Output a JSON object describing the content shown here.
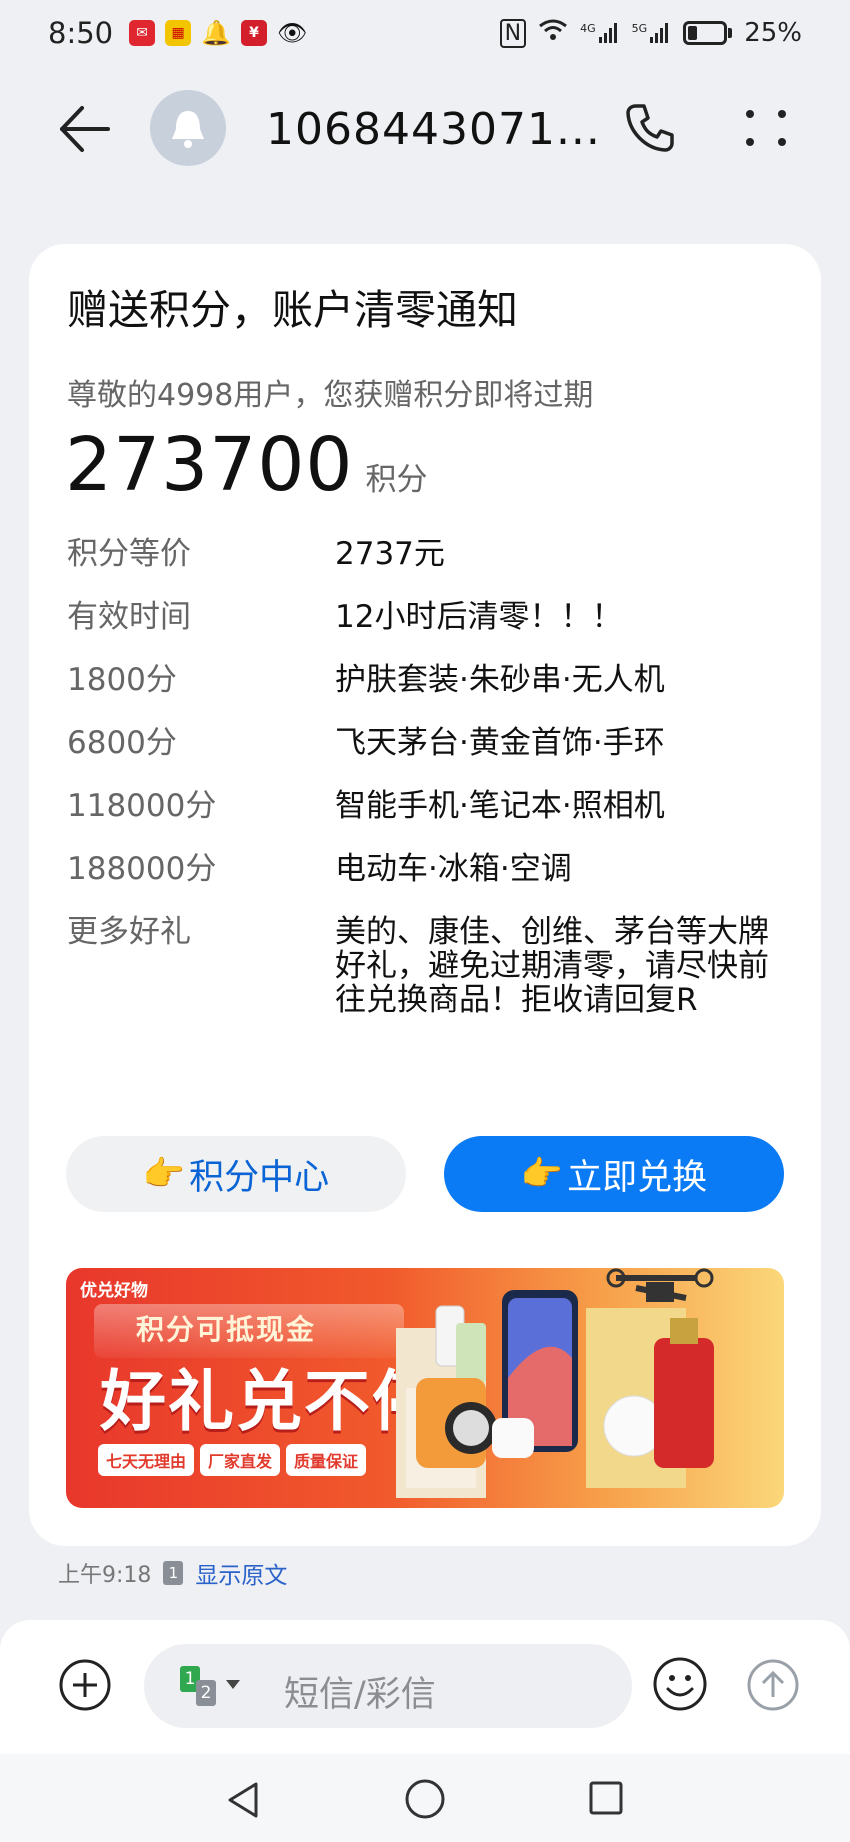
{
  "status_bar": {
    "time": "8:50",
    "network_4g": "4G",
    "network_5g": "5G",
    "battery": "25%"
  },
  "header": {
    "sender": "1068443071..."
  },
  "message": {
    "title": "赠送积分，账户清零通知",
    "subtitle": "尊敬的4998用户，您获赠积分即将过期",
    "points_value": "273700",
    "points_unit": "积分",
    "rows": [
      {
        "label": "积分等价",
        "value": "2737元"
      },
      {
        "label": "有效时间",
        "value": "12小时后清零！！！"
      },
      {
        "label": "1800分",
        "value": "护肤套装·朱砂串·无人机"
      },
      {
        "label": "6800分",
        "value": "飞天茅台·黄金首饰·手环"
      },
      {
        "label": "118000分",
        "value": "智能手机·笔记本·照相机"
      },
      {
        "label": "188000分",
        "value": "电动车·冰箱·空调"
      },
      {
        "label": "更多好礼",
        "value": "美的、康佳、创维、茅台等大牌好礼，避免过期清零，请尽快前往兑换商品！拒收请回复R"
      }
    ],
    "buttons": {
      "hand_emoji": "👉",
      "points_center": "积分中心",
      "redeem_now": "立即兑换"
    },
    "banner": {
      "brand": "优兑好物",
      "line1": "积分可抵现金",
      "line2": "好礼兑不停",
      "badges": [
        "七天无理由",
        "厂家直发",
        "质量保证"
      ]
    }
  },
  "meta": {
    "time": "上午9:18",
    "sim": "1",
    "show_original": "显示原文"
  },
  "composer": {
    "sim1": "1",
    "sim2": "2",
    "placeholder": "短信/彩信"
  },
  "colors": {
    "accent": "#0a7af5",
    "link": "#2a62c9",
    "banner_red": "#e8372c"
  }
}
